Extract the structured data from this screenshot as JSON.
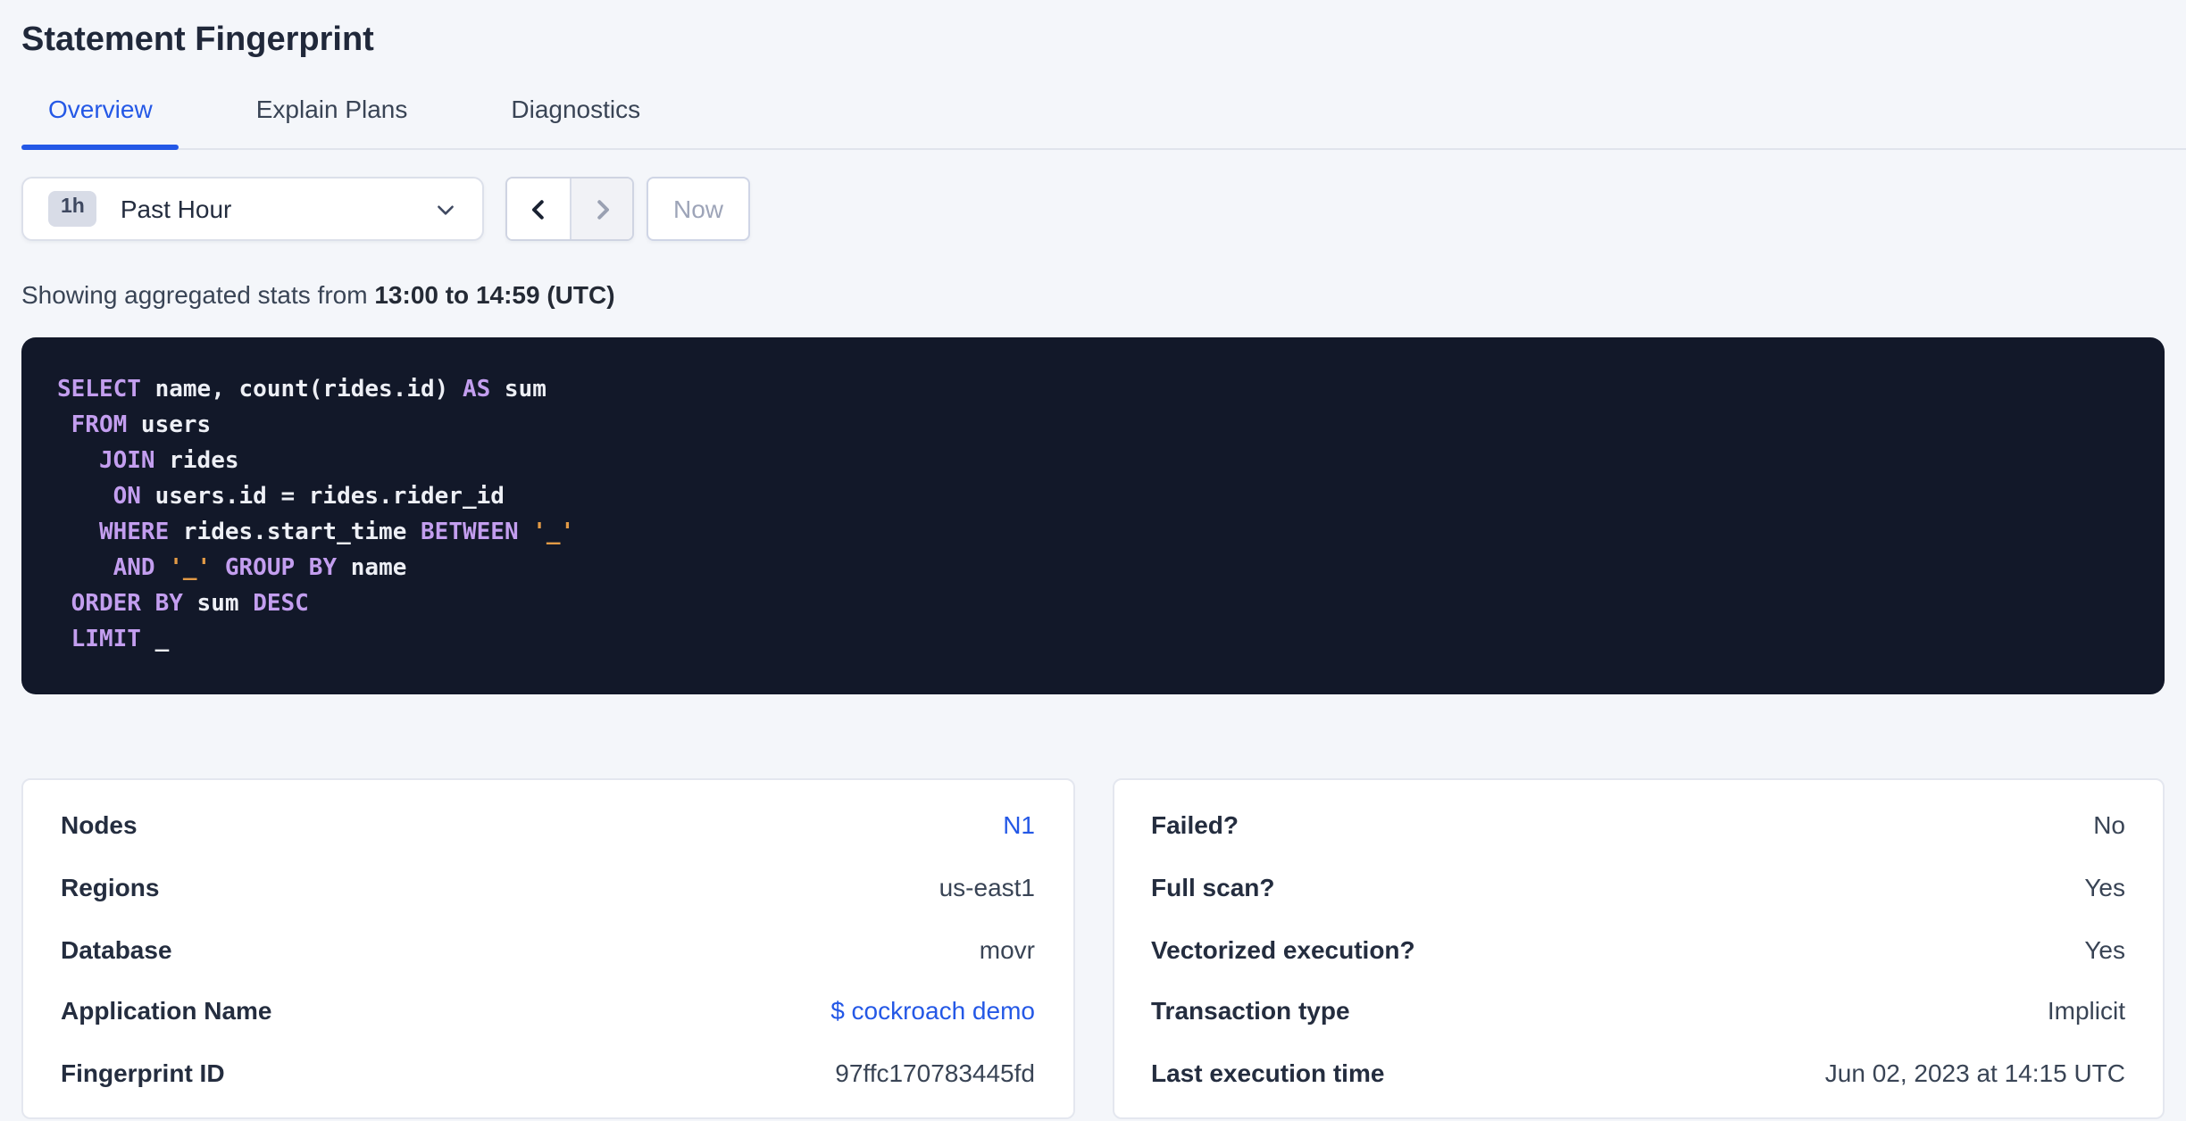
{
  "page": {
    "title": "Statement Fingerprint"
  },
  "tabs": [
    {
      "label": "Overview",
      "active": true
    },
    {
      "label": "Explain Plans",
      "active": false
    },
    {
      "label": "Diagnostics",
      "active": false
    }
  ],
  "toolbar": {
    "interval_badge": "1h",
    "interval_label": "Past Hour",
    "now_label": "Now"
  },
  "stats_line": {
    "prefix": "Showing aggregated stats from",
    "range": "13:00 to 14:59 (UTC)"
  },
  "sql": {
    "lines": [
      [
        [
          "k",
          "SELECT"
        ],
        [
          "i",
          " name, count(rides.id) "
        ],
        [
          "k",
          "AS"
        ],
        [
          "i",
          " sum"
        ]
      ],
      [
        [
          "i",
          " "
        ],
        [
          "k",
          "FROM"
        ],
        [
          "i",
          " users"
        ]
      ],
      [
        [
          "i",
          "   "
        ],
        [
          "k",
          "JOIN"
        ],
        [
          "i",
          " rides"
        ]
      ],
      [
        [
          "i",
          "    "
        ],
        [
          "k",
          "ON"
        ],
        [
          "i",
          " users.id = rides.rider_id"
        ]
      ],
      [
        [
          "i",
          "   "
        ],
        [
          "k",
          "WHERE"
        ],
        [
          "i",
          " rides.start_time "
        ],
        [
          "k",
          "BETWEEN"
        ],
        [
          "i",
          " "
        ],
        [
          "s",
          "'_'"
        ]
      ],
      [
        [
          "i",
          "    "
        ],
        [
          "k",
          "AND"
        ],
        [
          "i",
          " "
        ],
        [
          "s",
          "'_'"
        ],
        [
          "i",
          " "
        ],
        [
          "k",
          "GROUP BY"
        ],
        [
          "i",
          " name"
        ]
      ],
      [
        [
          "i",
          " "
        ],
        [
          "k",
          "ORDER BY"
        ],
        [
          "i",
          " sum "
        ],
        [
          "k",
          "DESC"
        ]
      ],
      [
        [
          "i",
          " "
        ],
        [
          "k",
          "LIMIT"
        ],
        [
          "i",
          " _"
        ]
      ]
    ]
  },
  "summary_cards": {
    "left": {
      "rows": [
        {
          "label": "Nodes",
          "value": "N1",
          "link": true
        },
        {
          "label": "Regions",
          "value": "us-east1",
          "link": false
        },
        {
          "label": "Database",
          "value": "movr",
          "link": false
        },
        {
          "label": "Application Name",
          "value": "$ cockroach demo",
          "link": true
        },
        {
          "label": "Fingerprint ID",
          "value": "97ffc170783445fd",
          "link": false
        }
      ]
    },
    "right": {
      "rows": [
        {
          "label": "Failed?",
          "value": "No",
          "link": false
        },
        {
          "label": "Full scan?",
          "value": "Yes",
          "link": false
        },
        {
          "label": "Vectorized execution?",
          "value": "Yes",
          "link": false
        },
        {
          "label": "Transaction type",
          "value": "Implicit",
          "link": false
        },
        {
          "label": "Last execution time",
          "value": "Jun 02, 2023 at 14:15 UTC",
          "link": false
        }
      ]
    }
  },
  "colors": {
    "page_bg": "#F4F6FA",
    "accent_blue": "#2458E6",
    "sql_bg": "#121829",
    "sql_keyword": "#C39EEF",
    "sql_identifier": "#EDEFF5",
    "sql_literal": "#E29A46",
    "title_text": "#20283A",
    "body_text": "#394455"
  }
}
